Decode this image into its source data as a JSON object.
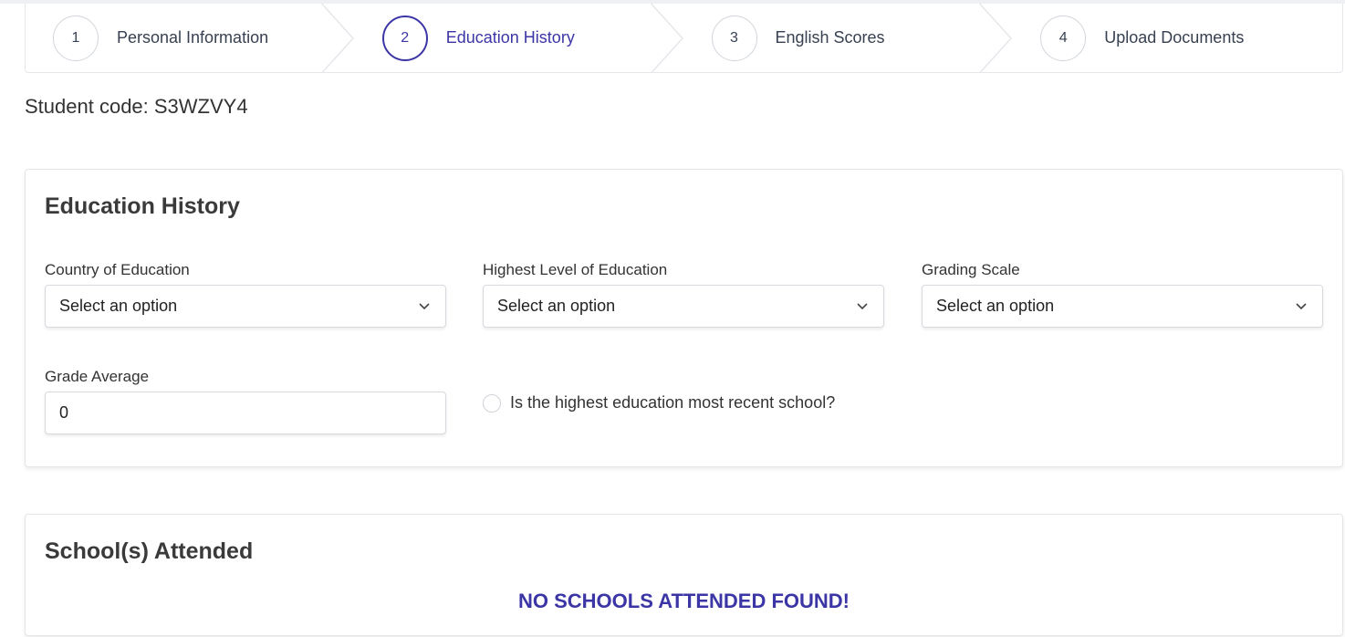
{
  "stepper": {
    "steps": [
      {
        "number": "1",
        "label": "Personal Information"
      },
      {
        "number": "2",
        "label": "Education History"
      },
      {
        "number": "3",
        "label": "English Scores"
      },
      {
        "number": "4",
        "label": "Upload Documents"
      }
    ],
    "active_step": 2
  },
  "student_code": "Student code: S3WZVY4",
  "education_history": {
    "title": "Education History",
    "country": {
      "label": "Country of Education",
      "value": "Select an option"
    },
    "level": {
      "label": "Highest Level of Education",
      "value": "Select an option"
    },
    "grading_scale": {
      "label": "Grading Scale",
      "value": "Select an option"
    },
    "grade_average": {
      "label": "Grade Average",
      "value": "0"
    },
    "recent_school": {
      "label": "Is the highest education most recent school?",
      "checked": false
    }
  },
  "schools": {
    "title": "School(s) Attended",
    "empty_message": "NO SCHOOLS ATTENDED FOUND!"
  },
  "colors": {
    "accent": "#3b35a6",
    "border": "#d6d9de"
  }
}
